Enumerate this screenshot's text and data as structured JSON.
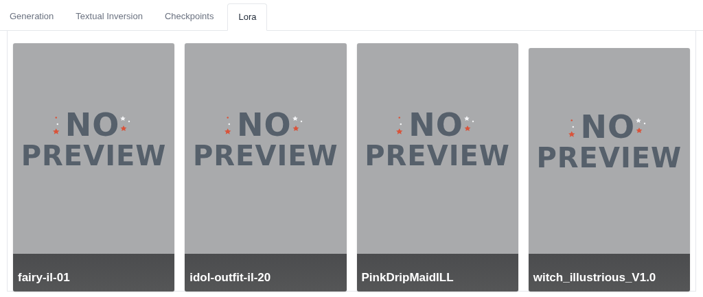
{
  "tabs": [
    {
      "label": "Generation",
      "selected": false
    },
    {
      "label": "Textual Inversion",
      "selected": false
    },
    {
      "label": "Checkpoints",
      "selected": false
    },
    {
      "label": "Lora",
      "selected": true
    }
  ],
  "cards": [
    {
      "placeholder_top": "NO",
      "placeholder_bottom": "PREVIEW",
      "name": "fairy-il-01"
    },
    {
      "placeholder_top": "NO",
      "placeholder_bottom": "PREVIEW",
      "name": "idol-outfit-il-20"
    },
    {
      "placeholder_top": "NO",
      "placeholder_bottom": "PREVIEW",
      "name": "PinkDripMaidILL"
    },
    {
      "placeholder_top": "NO",
      "placeholder_bottom": "PREVIEW",
      "name": "witch_illustrious_V1.0"
    }
  ]
}
